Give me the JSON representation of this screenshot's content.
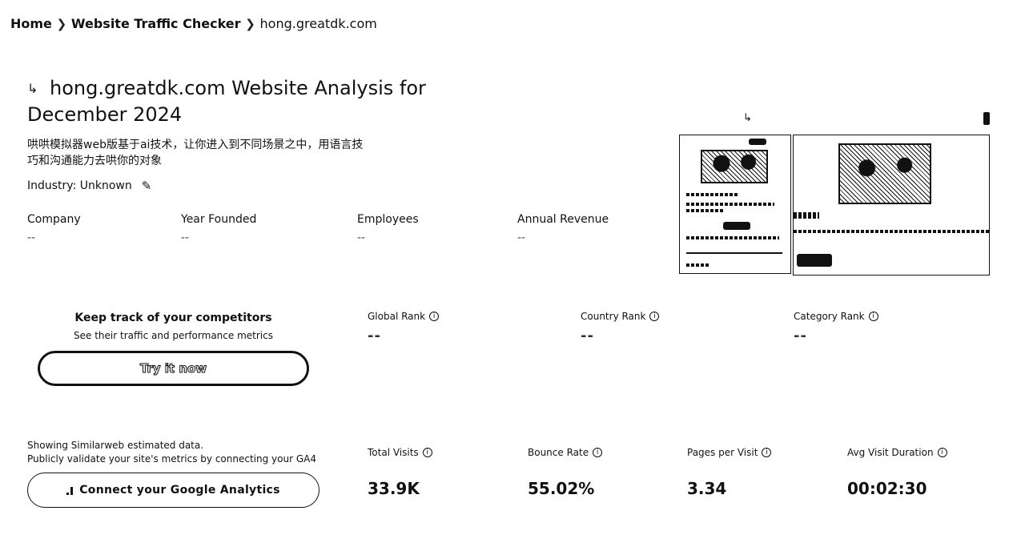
{
  "breadcrumb": {
    "home": "Home",
    "checker": "Website Traffic Checker",
    "current": "hong.greatdk.com"
  },
  "header": {
    "title": "hong.greatdk.com Website Analysis for December 2024",
    "description": "哄哄模拟器web版基于ai技术，让你进入到不同场景之中，用语言技巧和沟通能力去哄你的对象",
    "industry": "Industry: Unknown"
  },
  "facts": [
    {
      "label": "Company",
      "value": "--"
    },
    {
      "label": "Year Founded",
      "value": "--"
    },
    {
      "label": "Employees",
      "value": "--"
    },
    {
      "label": "Annual Revenue",
      "value": "--"
    }
  ],
  "competitors": {
    "title": "Keep track of your competitors",
    "subtitle": "See their traffic and performance metrics",
    "button": "Try it now"
  },
  "ranks": [
    {
      "label": "Global Rank",
      "value": "--"
    },
    {
      "label": "Country Rank",
      "value": "--"
    },
    {
      "label": "Category Rank",
      "value": "--"
    }
  ],
  "similarweb": {
    "line1": "Showing Similarweb estimated data.",
    "line2": "Publicly validate your site's metrics by connecting your GA4",
    "button": "Connect your Google Analytics"
  },
  "metrics": [
    {
      "label": "Total Visits",
      "value": "33.9K"
    },
    {
      "label": "Bounce Rate",
      "value": "55.02%"
    },
    {
      "label": "Pages per Visit",
      "value": "3.34"
    },
    {
      "label": "Avg Visit Duration",
      "value": "00:02:30"
    }
  ],
  "icons": {
    "chevron": "chevron-right-icon",
    "edit": "pencil-icon",
    "info": "info-icon",
    "analytics": "google-analytics-icon"
  }
}
